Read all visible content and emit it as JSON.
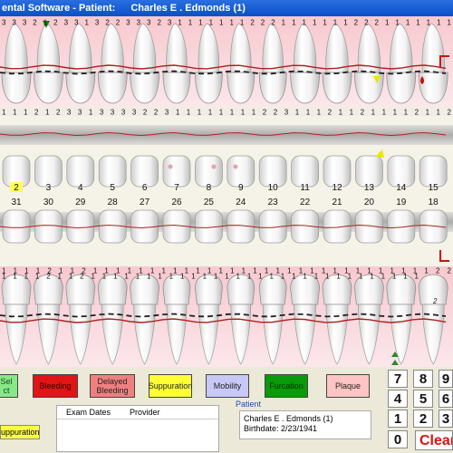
{
  "window": {
    "title_prefix": "ental Software - Patient:",
    "patient_name": "Charles E . Edmonds  (1)"
  },
  "upper": {
    "depth_row_top": "3 3 3 2 1 2 3 3 1 3 2 2 3 3 3 2 3 1 1 1 1 1 1 1 2 2 2 1 1 1 1 1 1 1 2 2 2 1 1 1 1 1 1 1",
    "depth_row_bottom": "1 1 1 2 1 2 3 3 1 3 3 3 3 2 2 3 1 1 1 1 1 1 1 1 2 2 3 1 1 1 2 1 1 2 1 1 1 1 2 1 1 2",
    "tooth_numbers": [
      "2",
      "3",
      "4",
      "5",
      "6",
      "7",
      "8",
      "9",
      "10",
      "11",
      "12",
      "13",
      "14",
      "15"
    ],
    "selected_tooth": "2"
  },
  "lower": {
    "tooth_numbers": [
      "31",
      "30",
      "29",
      "28",
      "27",
      "26",
      "25",
      "24",
      "23",
      "22",
      "21",
      "20",
      "19",
      "18"
    ],
    "depth_row": "1 1 1 1 2 1 1 2 1 1 1 1 1 1 1 1 1 1 1 1 1 1 1 1 1 1 1 1 1 1 1 1 1 1 1 1 1 1 2 2",
    "depth_row_bottom": "1 1 1 1 2 1 1 2 1 1 1 1 1 1 1 1 1 1 1 1 1 1 1 1 1 1 1 1 1 1 1 1 1 1 1 1 1 1"
  },
  "condition_buttons": [
    {
      "label": "Bleeding",
      "color": "#e01515",
      "text_color": "#3a0000"
    },
    {
      "label": "Delayed Bleeding",
      "color": "#f08080",
      "text_color": "#222222"
    },
    {
      "label": "Suppuration",
      "color": "#ffff33",
      "text_color": "#222222"
    },
    {
      "label": "Mobility",
      "color": "#c8c8f8",
      "text_color": "#222222"
    },
    {
      "label": "Furcation",
      "color": "#0a9a0a",
      "text_color": "#003300"
    },
    {
      "label": "Plaque",
      "color": "#ffc4c4",
      "text_color": "#222222"
    }
  ],
  "select_button_label": "Sel\nct",
  "suppuration_indicator": "uppuration",
  "exam_grid": {
    "col1": "Exam Dates",
    "col2": "Provider"
  },
  "patient_panel": {
    "label": "Patient",
    "name": "Charles E . Edmonds  (1)",
    "birthdate": "Birthdate: 2/23/1941"
  },
  "keypad": {
    "keys": [
      "7",
      "8",
      "9",
      "4",
      "5",
      "6",
      "1",
      "2",
      "3",
      "0"
    ],
    "clear": "Clear"
  }
}
